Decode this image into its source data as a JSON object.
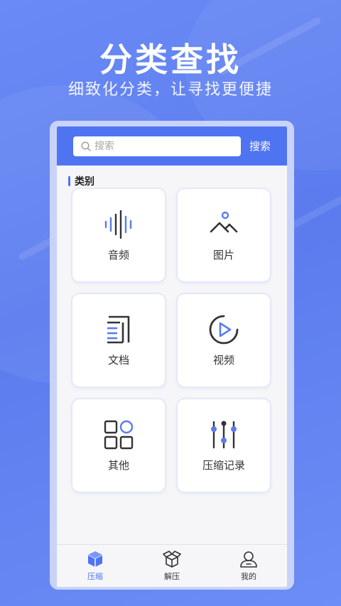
{
  "promo": {
    "headline": "分类查找",
    "subline": "细致化分类，让寻找更便捷"
  },
  "search": {
    "placeholder": "搜索",
    "button_label": "搜索"
  },
  "section": {
    "title": "类别"
  },
  "categories": [
    {
      "label": "音频",
      "icon": "audio-wave-icon"
    },
    {
      "label": "图片",
      "icon": "image-icon"
    },
    {
      "label": "文档",
      "icon": "document-icon"
    },
    {
      "label": "视频",
      "icon": "video-play-icon"
    },
    {
      "label": "其他",
      "icon": "other-grid-icon"
    },
    {
      "label": "压缩记录",
      "icon": "slider-settings-icon"
    }
  ],
  "tabs": [
    {
      "label": "压缩",
      "icon": "cube-icon",
      "active": true
    },
    {
      "label": "解压",
      "icon": "open-box-icon",
      "active": false
    },
    {
      "label": "我的",
      "icon": "user-icon",
      "active": false
    }
  ],
  "colors": {
    "accent": "#4f74f2",
    "background": "#5f80f0",
    "icon_dark": "#333333",
    "icon_accent": "#5b7cf0"
  }
}
